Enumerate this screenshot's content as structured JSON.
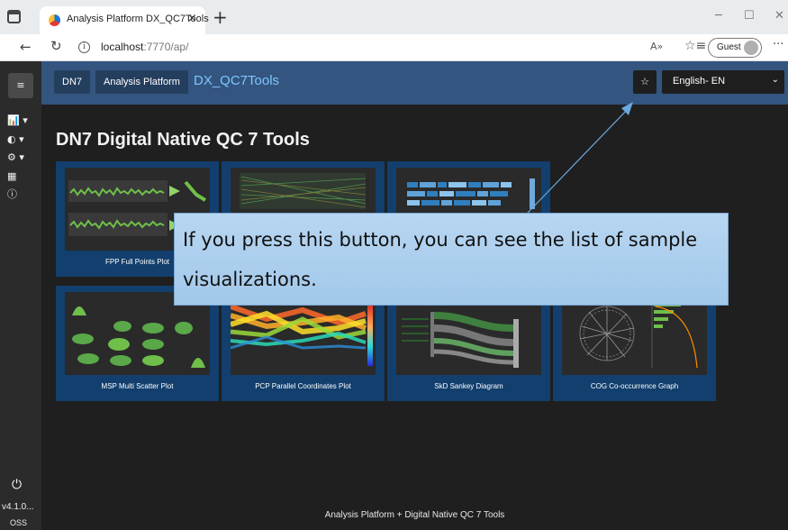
{
  "browser": {
    "tab_title": "Analysis Platform DX_QC7Tools",
    "tab_close": "×",
    "new_tab": "+",
    "url_host": "localhost",
    "url_path": ":7770/ap/",
    "guest_label": "Guest",
    "window_minimize": "─",
    "window_maximize": "☐",
    "window_close": "✕",
    "back_glyph": "←",
    "reload_glyph": "↻",
    "more_glyph": "···",
    "read_aloud_glyph": "A»",
    "favorites_glyph": "☆≡"
  },
  "header": {
    "dn7_label": "DN7",
    "analysis_platform_label": "Analysis Platform",
    "app_title": "DX_QC7Tools",
    "star_glyph": "☆",
    "language_selected": "English- EN",
    "language_chevron": "⌄"
  },
  "sidebar": {
    "menu_glyph": "≡",
    "items": [
      {
        "name": "chart",
        "glyph": "📊 ▾"
      },
      {
        "name": "analysis",
        "glyph": "◐ ▾"
      },
      {
        "name": "settings",
        "glyph": "⚙ ▾"
      },
      {
        "name": "table",
        "glyph": "▦"
      },
      {
        "name": "info",
        "glyph": "ⓘ"
      }
    ],
    "power_glyph": "⏻",
    "version": "v4.1.0...",
    "oss": "OSS"
  },
  "main": {
    "title": "DN7 Digital Native QC 7 Tools",
    "cards": [
      {
        "label": "FPP Full Points Plot"
      },
      {
        "label": ""
      },
      {
        "label": ""
      },
      {
        "label": "MSP Multi Scatter Plot"
      },
      {
        "label": "PCP Parallel Coordinates Plot"
      },
      {
        "label": "SkD Sankey Diagram"
      },
      {
        "label": "COG Co-occurrence Graph"
      }
    ]
  },
  "callout": {
    "text": "If you press this button, you can see the list of sample visualizations."
  },
  "footer": {
    "text": "Analysis Platform + Digital Native QC 7 Tools"
  },
  "colors": {
    "header_bg": "#33557f",
    "card_bg": "#123f6e",
    "callout_bg": "#b7d6f1",
    "title_accent": "#7ec6ff"
  }
}
